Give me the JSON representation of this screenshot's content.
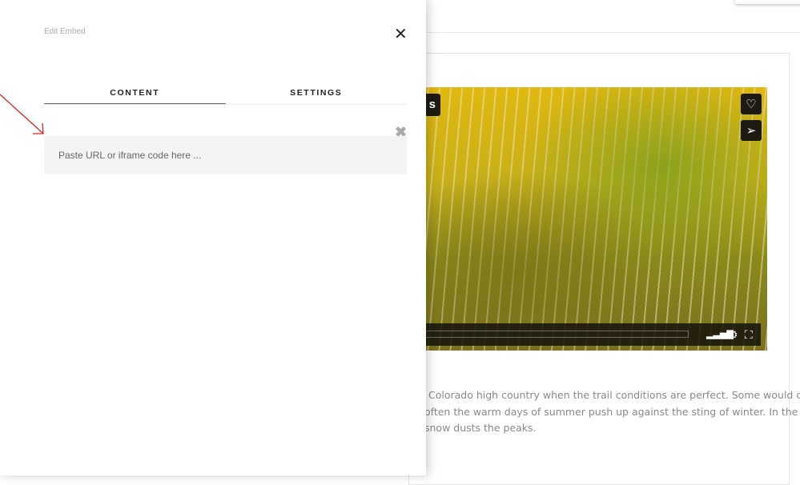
{
  "panel": {
    "title": "Edit Embed",
    "tabs": [
      {
        "label": "CONTENT",
        "active": true
      },
      {
        "label": "SETTINGS",
        "active": false
      }
    ],
    "input_placeholder": "Paste URL or iframe code here ...",
    "input_value": ""
  },
  "background": {
    "video_title_fragment": "s",
    "heading_fragment": "s",
    "paragraph_lines": [
      "Colorado high country when the trail conditions are perfect. Some would call it",
      "often the warm days of summer push up against the sting of winter. In the high",
      "snow dusts the peaks."
    ]
  },
  "colors": {
    "annotation_arrow": "#e02020",
    "input_bg": "#f4f4f4"
  }
}
